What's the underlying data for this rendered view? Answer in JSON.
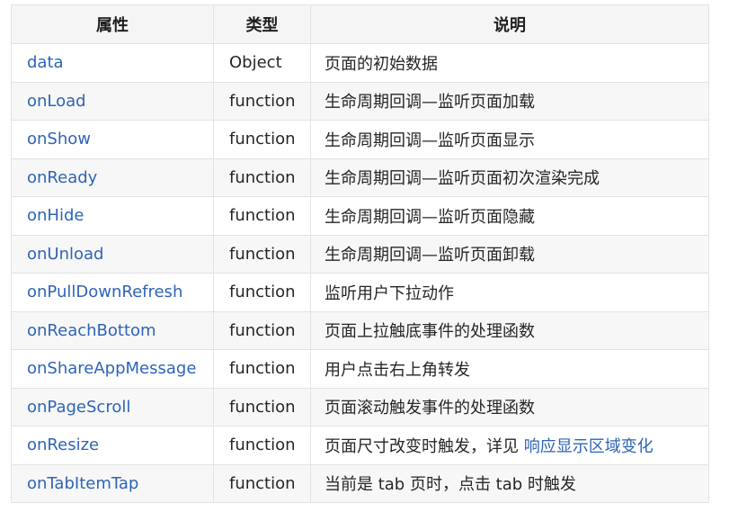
{
  "headers": [
    "属性",
    "类型",
    "说明"
  ],
  "rows": [
    {
      "prop": "data",
      "type": "Object",
      "desc": "页面的初始数据"
    },
    {
      "prop": "onLoad",
      "type": "function",
      "desc": "生命周期回调—监听页面加载"
    },
    {
      "prop": "onShow",
      "type": "function",
      "desc": "生命周期回调—监听页面显示"
    },
    {
      "prop": "onReady",
      "type": "function",
      "desc": "生命周期回调—监听页面初次渲染完成"
    },
    {
      "prop": "onHide",
      "type": "function",
      "desc": "生命周期回调—监听页面隐藏"
    },
    {
      "prop": "onUnload",
      "type": "function",
      "desc": "生命周期回调—监听页面卸载"
    },
    {
      "prop": "onPullDownRefresh",
      "type": "function",
      "desc": "监听用户下拉动作"
    },
    {
      "prop": "onReachBottom",
      "type": "function",
      "desc": "页面上拉触底事件的处理函数"
    },
    {
      "prop": "onShareAppMessage",
      "type": "function",
      "desc": "用户点击右上角转发"
    },
    {
      "prop": "onPageScroll",
      "type": "function",
      "desc": "页面滚动触发事件的处理函数"
    },
    {
      "prop": "onResize",
      "type": "function",
      "desc": "页面尺寸改变时触发，详见 ",
      "link": "响应显示区域变化"
    },
    {
      "prop": "onTabItemTap",
      "type": "function",
      "desc": "当前是 tab 页时，点击 tab 时触发"
    }
  ]
}
